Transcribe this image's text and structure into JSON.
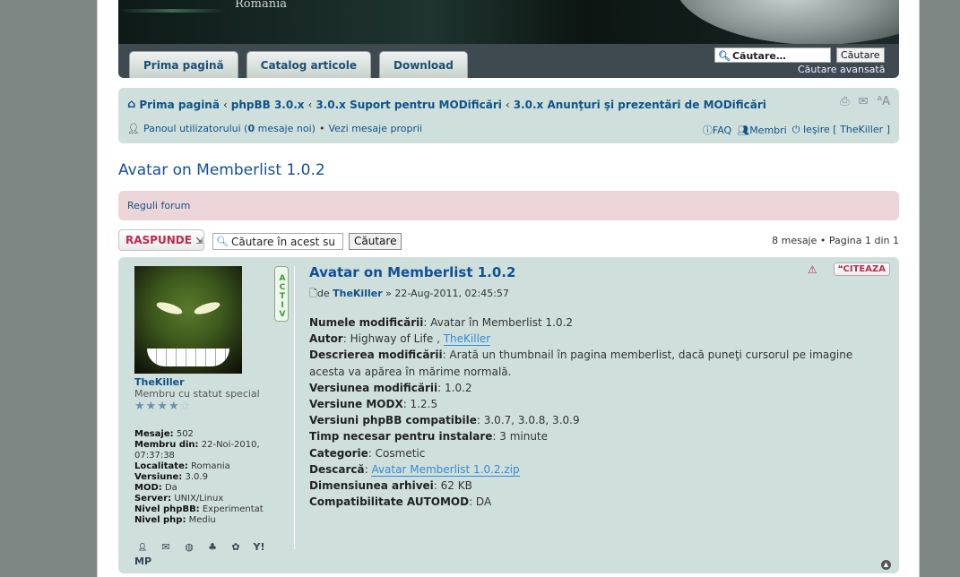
{
  "header": {
    "site_name": "Romania",
    "tabs": [
      "Prima pagină",
      "Catalog articole",
      "Download"
    ],
    "search_value": "Căutare…",
    "search_button": "Căutare",
    "advanced_search": "Căutare avansată"
  },
  "navbar": {
    "breadcrumbs": [
      "Prima pagină",
      "phpBB 3.0.x",
      "3.0.x Suport pentru MODificări",
      "3.0.x Anunţuri şi prezentări de MODificări"
    ],
    "crumb_sep": "‹",
    "user_panel_prefix": "Panoul utilizatorului (",
    "new_messages_count": "0",
    "user_panel_suffix": " mesaje noi)",
    "bullet": "•",
    "own_posts": "Vezi mesaje proprii",
    "faq": "FAQ",
    "members": "Membri",
    "logout": "Ieşire [ TheKiller ]"
  },
  "topic_title": "Avatar on Memberlist 1.0.2",
  "forum_rules": "Reguli forum",
  "actions": {
    "reply_label": "RASPUNDE",
    "topic_search_value": "Căutare în acest su",
    "topic_search_button": "Căutare",
    "pagination": "8 mesaje • Pagina 1 din 1"
  },
  "post": {
    "title": "Avatar on Memberlist 1.0.2",
    "by_prefix": "de",
    "author": "TheKiller",
    "date": "» 22-Aug-2011, 02:45:57",
    "report_label": "!",
    "quote_label": "CITEAZA",
    "content": {
      "mod_name_label": "Numele modificării",
      "mod_name_value": ": Avatar în Memberlist 1.0.2",
      "author_label": "Autor",
      "author_value": ": Highway of Life , ",
      "author_link": "TheKiller",
      "desc_label": "Descrierea modificării",
      "desc_value": ": Arată un thumbnail în pagina memberlist, dacă puneţi cursorul pe imagine acesta va apărea în mărime normală.",
      "version_label": "Versiunea modificării",
      "version_value": ": 1.0.2",
      "modx_label": "Versiune MODX",
      "modx_value": ": 1.2.5",
      "phpbb_label": "Versiuni phpBB compatibile",
      "phpbb_value": ": 3.0.7, 3.0.8, 3.0.9",
      "time_label": "Timp necesar pentru instalare",
      "time_value": ": 3 minute",
      "category_label": "Categorie",
      "category_value": ": Cosmetic",
      "download_label": "Descarcă",
      "download_prefix": ": ",
      "download_link": "Avatar Memberlist 1.0.2.zip",
      "size_label": "Dimensiunea arhivei",
      "size_value": ": 62 KB",
      "automod_label": "Compatibilitate AUTOMOD",
      "automod_value": ": DA"
    }
  },
  "profile": {
    "name": "TheKiller",
    "rank": "Membru cu statut special",
    "stars_on": "★★★★",
    "stars_off": "☆",
    "active_badge": "ACTIV",
    "details": [
      {
        "label": "Mesaje:",
        "value": " 502"
      },
      {
        "label": "Membru din:",
        "value": " 22-Noi-2010, 07:37:38"
      },
      {
        "label": "Localitate:",
        "value": " Romania"
      },
      {
        "label": "Versiune:",
        "value": " 3.0.9"
      },
      {
        "label": "MOD:",
        "value": " Da"
      },
      {
        "label": "Server:",
        "value": " UNIX/Linux"
      },
      {
        "label": "Nivel phpBB:",
        "value": " Experimentat"
      },
      {
        "label": "Nivel php:",
        "value": " Mediu"
      }
    ],
    "contact_pm": "MP"
  }
}
